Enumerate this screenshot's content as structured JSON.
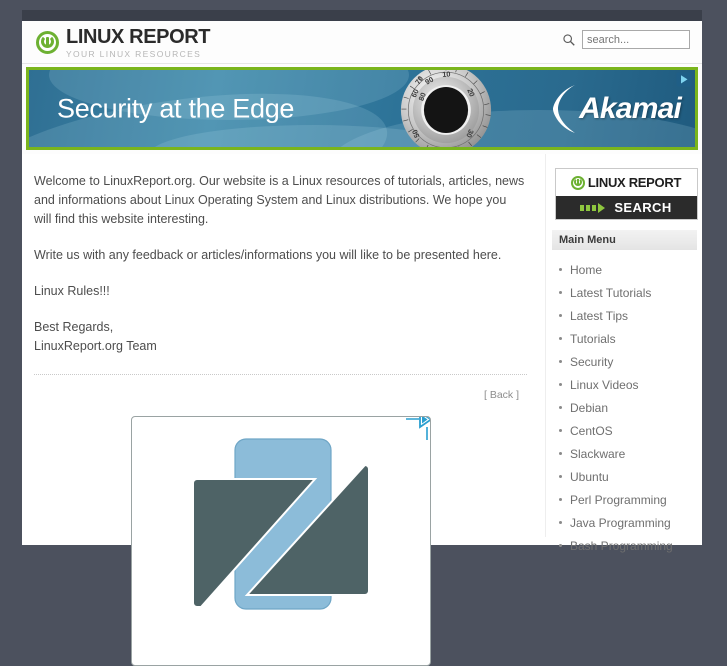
{
  "header": {
    "logo_title": "LINUX REPORT",
    "logo_tagline": "YOUR LINUX RESOURCES",
    "search_placeholder": "search...",
    "search_value": ""
  },
  "banner_ad": {
    "headline": "Security at the Edge",
    "brand": "Akamai",
    "adchoices_label": "AdChoices",
    "border_color": "#7ab51d",
    "background_color": "#2d7398"
  },
  "main": {
    "paragraphs": [
      "Welcome to LinuxReport.org. Our website is a Linux resources of tutorials, articles, news and informations about Linux Operating System and Linux distributions. We hope you will find this website interesting.",
      "Write us with any feedback or articles/informations you will like to be presented here.",
      "Linux Rules!!!"
    ],
    "signoff_line1": "Best Regards,",
    "signoff_line2": "LinuxReport.org Team",
    "back_link": "[ Back ]"
  },
  "square_ad": {
    "adchoices_label": "AdChoices",
    "logo_shape": "z-logo",
    "color_light": "#8cbcd9",
    "color_dark": "#4e6366"
  },
  "sidebar": {
    "search_widget": {
      "title": "LINUX REPORT",
      "button_label": "SEARCH"
    },
    "menu_title": "Main Menu",
    "menu_items": [
      {
        "label": "Home"
      },
      {
        "label": "Latest Tutorials"
      },
      {
        "label": "Latest Tips"
      },
      {
        "label": "Tutorials"
      },
      {
        "label": "Security"
      },
      {
        "label": "Linux Videos"
      },
      {
        "label": "Debian"
      },
      {
        "label": "CentOS"
      },
      {
        "label": "Slackware"
      },
      {
        "label": "Ubuntu"
      },
      {
        "label": "Perl Programming"
      },
      {
        "label": "Java Programming"
      },
      {
        "label": "Bash Programming"
      }
    ]
  },
  "theme": {
    "page_background": "#4c515e",
    "accent_green": "#6db132",
    "top_bar": "#3a3f4a"
  }
}
